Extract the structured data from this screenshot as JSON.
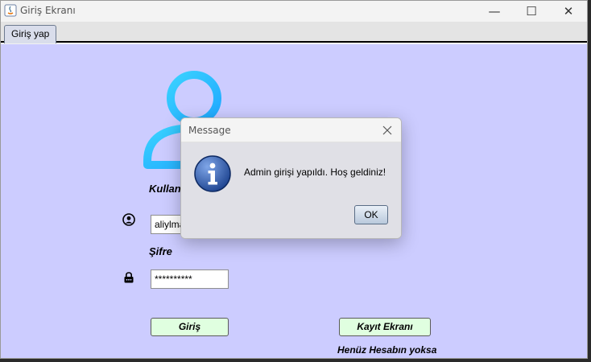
{
  "window": {
    "title": "Giriş Ekranı",
    "controls": {
      "minimize": "—",
      "maximize": "☐",
      "close": "✕"
    }
  },
  "tabs": [
    {
      "label": "Giriş yap",
      "selected": true
    }
  ],
  "login_form": {
    "username_label": "Kullanıcı Adı",
    "username_value": "aliylmaz",
    "password_label": "Şifre",
    "password_value": "**********",
    "login_button": "Giriş",
    "register_button": "Kayıt Ekranı",
    "register_hint": "Henüz Hesabın yoksa",
    "icons": {
      "avatar": "user-avatar-icon",
      "user": "user-circle-icon",
      "lock": "lock-icon"
    }
  },
  "dialog": {
    "title": "Message",
    "message": "Admin girişi yapıldı. Hoş geldiniz!",
    "ok_button": "OK",
    "icon": "info-icon"
  },
  "colors": {
    "panel_background": "#ccccff",
    "avatar_gradient": [
      "#3ad2ff",
      "#1fa8ff"
    ],
    "button_background": "#e0ffe0"
  }
}
